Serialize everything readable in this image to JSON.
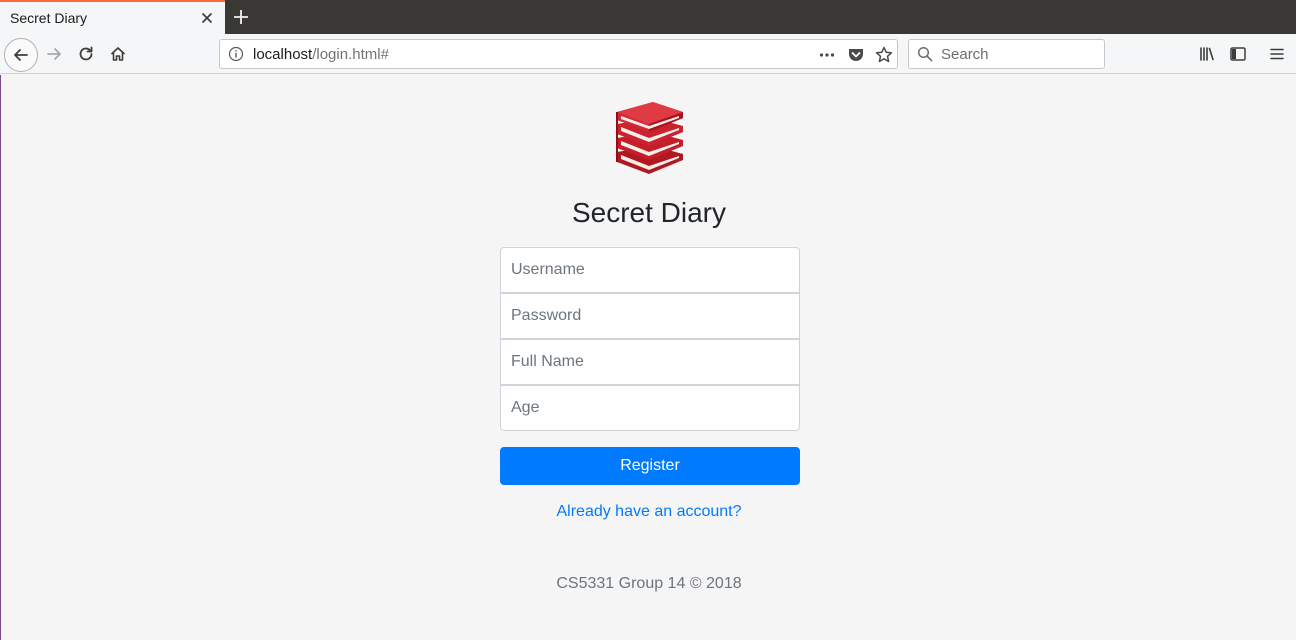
{
  "browser": {
    "tab_title": "Secret Diary",
    "url_host": "localhost",
    "url_path": "/login.html#",
    "search_placeholder": "Search",
    "accent_color": "#ff6a3d",
    "icons": [
      "close-icon",
      "plus-icon",
      "back-arrow-icon",
      "forward-arrow-icon",
      "reload-icon",
      "home-icon",
      "info-icon",
      "more-dots-icon",
      "pocket-icon",
      "star-icon",
      "search-icon",
      "library-icon",
      "sidebar-icon",
      "hamburger-menu-icon"
    ]
  },
  "page": {
    "logo_icon": "book-stack-icon",
    "title": "Secret Diary",
    "form": {
      "username_placeholder": "Username",
      "password_placeholder": "Password",
      "fullname_placeholder": "Full Name",
      "age_placeholder": "Age",
      "register_label": "Register",
      "register_color": "#007bff"
    },
    "account_link": "Already have an account?",
    "footer": "CS5331 Group 14 © 2018"
  }
}
